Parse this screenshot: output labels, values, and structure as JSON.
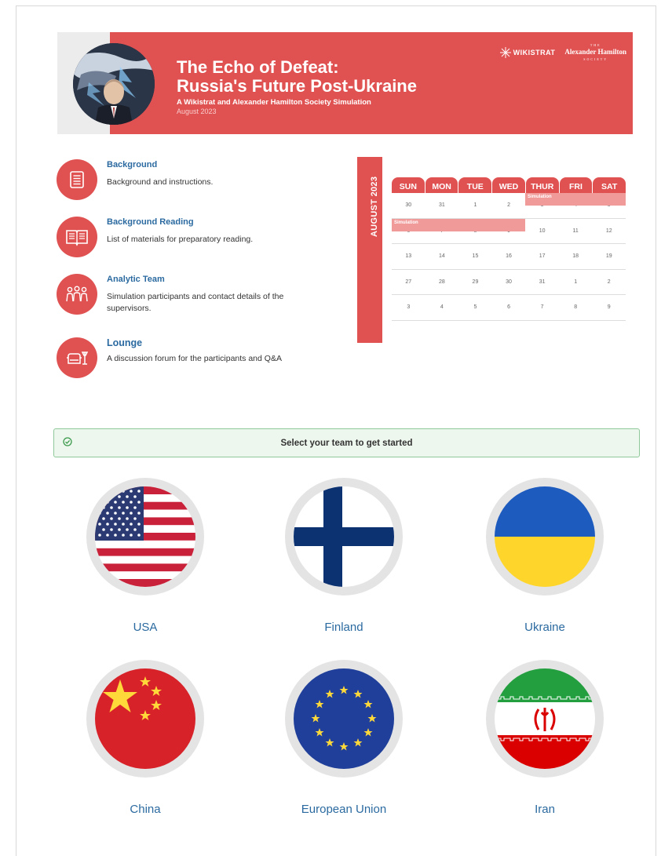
{
  "banner": {
    "title_line1": "The Echo of Defeat:",
    "title_line2": "Russia's Future Post-Ukraine",
    "subtitle": "A Wikistrat and Alexander Hamilton Society Simulation",
    "date": "August 2023",
    "logo_wikistrat": "WIKISTRAT",
    "logo_ahs_top": "THE",
    "logo_ahs_name": "Alexander Hamilton",
    "logo_ahs_bottom": "SOCIETY"
  },
  "menu": [
    {
      "title": "Background",
      "desc": "Background and instructions.",
      "icon": "document-icon"
    },
    {
      "title": "Background Reading",
      "desc": "List of materials for preparatory reading.",
      "icon": "open-book-icon"
    },
    {
      "title": "Analytic Team",
      "desc": "Simulation participants and contact details of the supervisors.",
      "icon": "team-icon"
    },
    {
      "title": "Lounge",
      "desc": "A discussion forum for the participants and Q&A",
      "icon": "lounge-icon"
    }
  ],
  "calendar": {
    "month_label": "AUGUST 2023",
    "days": [
      "SUN",
      "MON",
      "TUE",
      "WED",
      "THUR",
      "FRI",
      "SAT"
    ],
    "weeks": [
      [
        "30",
        "31",
        "1",
        "2",
        "3",
        "4",
        "5"
      ],
      [
        "6",
        "7",
        "8",
        "9",
        "10",
        "11",
        "12"
      ],
      [
        "13",
        "14",
        "15",
        "16",
        "17",
        "18",
        "19"
      ],
      [
        "27",
        "28",
        "29",
        "30",
        "31",
        "1",
        "2"
      ],
      [
        "3",
        "4",
        "5",
        "6",
        "7",
        "8",
        "9"
      ]
    ],
    "event_label": "Simulation"
  },
  "alert": {
    "text": "Select your team to get started"
  },
  "teams": [
    {
      "name": "USA"
    },
    {
      "name": "Finland"
    },
    {
      "name": "Ukraine"
    },
    {
      "name": "China"
    },
    {
      "name": "European Union"
    },
    {
      "name": "Iran"
    }
  ],
  "colors": {
    "accent": "#e05252",
    "link": "#2b6aa0",
    "success_border": "#8fc89a"
  }
}
